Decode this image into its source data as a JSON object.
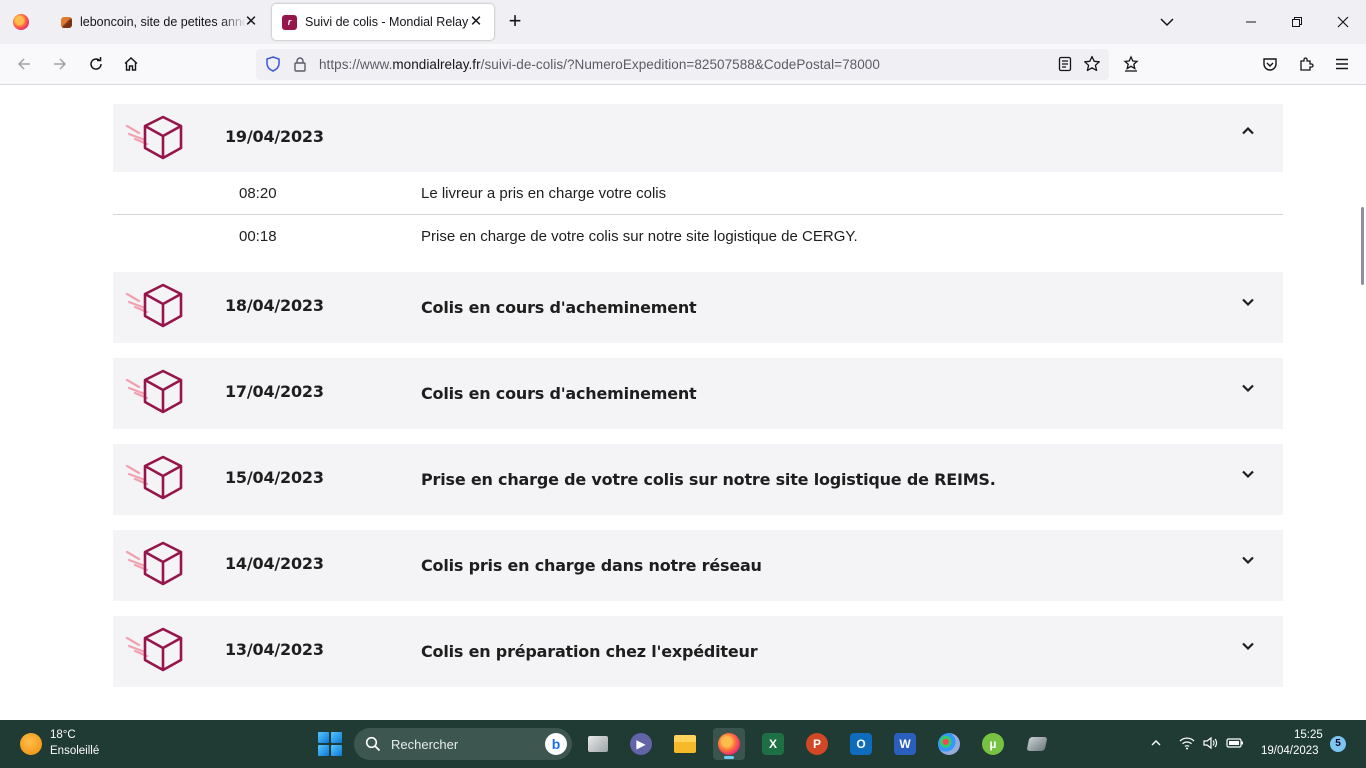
{
  "browser": {
    "tabs": [
      {
        "title": "leboncoin, site de petites annonces",
        "active": false
      },
      {
        "title": "Suivi de colis - Mondial Relay",
        "active": true
      }
    ],
    "close_glyph": "✕",
    "new_tab_glyph": "+",
    "url": {
      "prefix": "https://www.",
      "host": "mondialrelay.fr",
      "path": "/suivi-de-colis/?NumeroExpedition=82507588&CodePostal=78000"
    }
  },
  "tracking": {
    "expanded": {
      "date": "19/04/2023",
      "events": [
        {
          "time": "08:20",
          "description": "Le livreur a pris en charge votre colis"
        },
        {
          "time": "00:18",
          "description": "Prise en charge de votre colis sur notre site logistique de CERGY."
        }
      ]
    },
    "collapsed": [
      {
        "date": "18/04/2023",
        "status": "Colis en cours d'acheminement"
      },
      {
        "date": "17/04/2023",
        "status": "Colis en cours d'acheminement"
      },
      {
        "date": "15/04/2023",
        "status": "Prise en charge de votre colis sur notre site logistique de REIMS."
      },
      {
        "date": "14/04/2023",
        "status": "Colis pris en charge dans notre réseau"
      },
      {
        "date": "13/04/2023",
        "status": "Colis en préparation chez l'expéditeur"
      }
    ],
    "brand_color": "#96154a",
    "accent_color": "#f2a0b0"
  },
  "taskbar": {
    "weather": {
      "temp": "18°C",
      "desc": "Ensoleillé"
    },
    "search_placeholder": "Rechercher",
    "clock": {
      "time": "15:25",
      "date": "19/04/2023"
    },
    "notifications": "5",
    "apps": [
      "file-explorer-multitask",
      "teams",
      "file-explorer",
      "firefox",
      "excel",
      "powerpoint",
      "outlook",
      "word",
      "paint",
      "utorrent",
      "other"
    ]
  }
}
